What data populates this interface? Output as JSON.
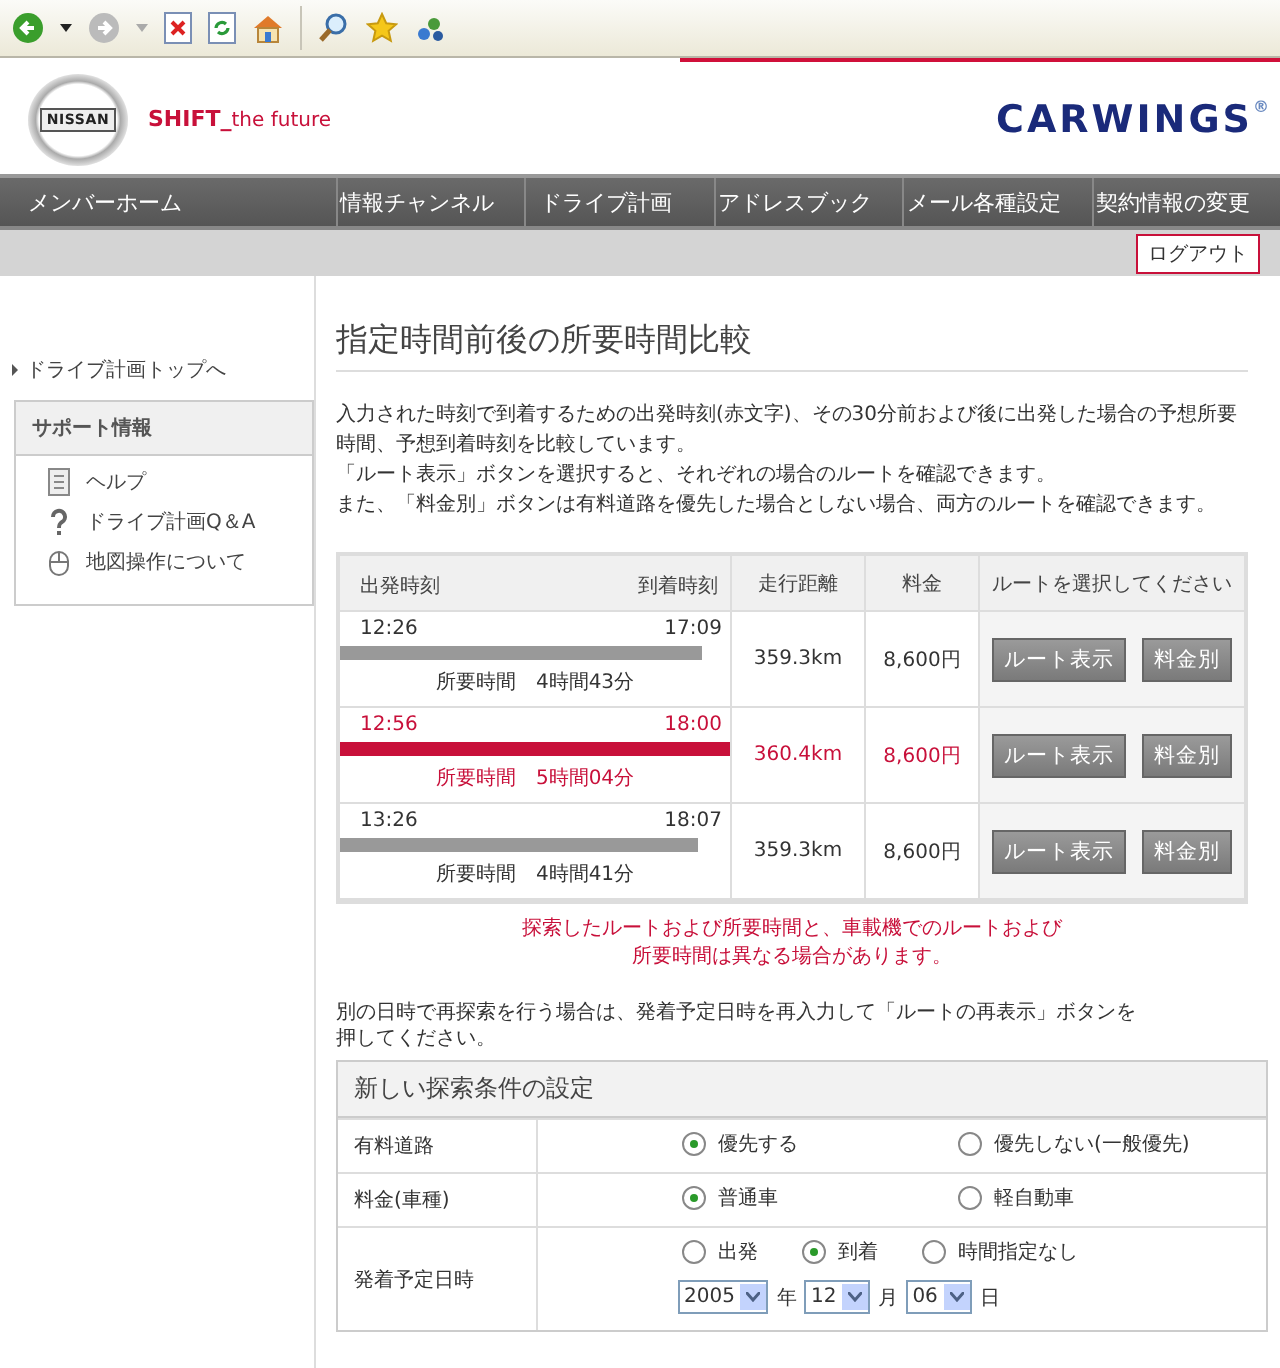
{
  "header": {
    "logo_text": "NISSAN",
    "tagline_strong": "SHIFT_",
    "tagline": "the future",
    "service_logo": "CARWINGS",
    "registered_mark": "®"
  },
  "nav": [
    "メンバーホーム",
    "情報チャンネル",
    "ドライブ計画",
    "アドレスブック",
    "メール各種設定",
    "契約情報の変更"
  ],
  "logout": "ログアウト",
  "sidebar": {
    "top_link": "ドライブ計画トップへ",
    "support": {
      "title": "サポート情報",
      "items": [
        {
          "label": "ヘルプ",
          "kind": "document"
        },
        {
          "label": "ドライブ計画Q＆A",
          "kind": "question"
        },
        {
          "label": "地図操作について",
          "kind": "mouse"
        }
      ]
    }
  },
  "main": {
    "title": "指定時間前後の所要時間比較",
    "description": [
      "入力された時刻で到着するための出発時刻(赤文字)、その30分前および後に出発した場合の予想所要時間、予想到着時刻を比較しています。",
      "「ルート表示」ボタンを選択すると、それぞれの場合のルートを確認できます。",
      "また、「料金別」ボタンは有料道路を優先した場合としない場合、両方のルートを確認できます。"
    ],
    "table": {
      "columns": [
        "出発時刻",
        "到着時刻",
        "走行距離",
        "料金",
        "ルートを選択してください"
      ],
      "rows": [
        {
          "depart": "12:26",
          "arrive": "17:09",
          "level": 0.93,
          "duration_label": "所要時間",
          "duration": "4時間43分",
          "distance": "359.3km",
          "fee": "8,600円",
          "buttons": [
            "ルート表示",
            "料金別"
          ],
          "selected": false
        },
        {
          "depart": "12:56",
          "arrive": "18:00",
          "level": 1.0,
          "duration_label": "所要時間",
          "duration": "5時間04分",
          "distance": "360.4km",
          "fee": "8,600円",
          "buttons": [
            "ルート表示",
            "料金別"
          ],
          "selected": true
        },
        {
          "depart": "13:26",
          "arrive": "18:07",
          "level": 0.92,
          "duration_label": "所要時間",
          "duration": "4時間41分",
          "distance": "359.3km",
          "fee": "8,600円",
          "buttons": [
            "ルート表示",
            "料金別"
          ],
          "selected": false
        }
      ]
    },
    "note": [
      "探索したルートおよび所要時間と、車載機でのルートおよび",
      "所要時間は異なる場合があります。"
    ],
    "instruction": [
      "別の日時で再探索を行う場合は、発着予定日時を再入力して「ルートの再表示」ボタンを",
      "押してください。"
    ],
    "form": {
      "title": "新しい探索条件の設定",
      "rows": [
        {
          "label": "有料道路",
          "kind": "radio",
          "options": [
            {
              "label": "優先する",
              "selected": true
            },
            {
              "label": "優先しない(一般優先)",
              "selected": false
            }
          ]
        },
        {
          "label": "料金(車種)",
          "kind": "radio",
          "options": [
            {
              "label": "普通車",
              "selected": true
            },
            {
              "label": "軽自動車",
              "selected": false
            }
          ]
        },
        {
          "label": "発着予定日時",
          "kind": "datetime",
          "options": [
            {
              "label": "出発",
              "selected": false
            },
            {
              "label": "到着",
              "selected": true
            },
            {
              "label": "時間指定なし",
              "selected": false
            }
          ],
          "date": [
            {
              "value": "2005",
              "unit": "年"
            },
            {
              "value": "12",
              "unit": "月"
            },
            {
              "value": "06",
              "unit": "日"
            }
          ]
        }
      ]
    }
  }
}
